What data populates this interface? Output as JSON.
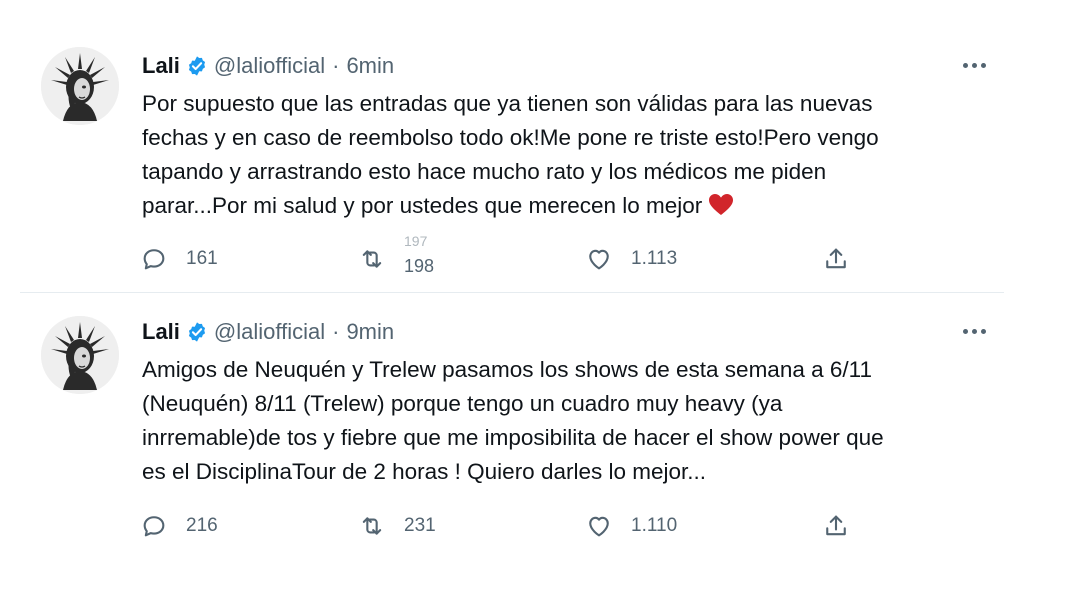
{
  "tweets": [
    {
      "display_name": "Lali",
      "handle": "@laliofficial",
      "separator": "·",
      "time": "6min",
      "lines": [
        "Por supuesto que las entradas que ya tienen son válidas para las nuevas",
        "fechas y en caso de reembolso todo ok!Me pone re triste esto!Pero vengo",
        "tapando y arrastrando esto hace mucho rato y los médicos me piden",
        "parar...Por mi salud y por ustedes que merecen lo mejor"
      ],
      "emoji": "red-heart",
      "replies": "161",
      "retweets_ghost": "197",
      "retweets": "198",
      "likes": "1.113"
    },
    {
      "display_name": "Lali",
      "handle": "@laliofficial",
      "separator": "·",
      "time": "9min",
      "lines": [
        "Amigos de Neuquén y Trelew pasamos los shows de esta semana a 6/11",
        "(Neuquén) 8/11 (Trelew) porque tengo un cuadro muy heavy (ya",
        "inrremable)de tos y fiebre que me imposibilita de hacer el show power que",
        "es el DisciplinaTour de 2 horas ! Quiero darles lo mejor..."
      ],
      "replies": "216",
      "retweets": "231",
      "likes": "1.110"
    }
  ],
  "icons": {
    "verified": "verified-badge-icon",
    "more": "more-options-icon",
    "reply": "reply-icon",
    "retweet": "retweet-icon",
    "like": "like-icon",
    "share": "share-icon"
  },
  "colors": {
    "verified_blue": "#1d9bf0",
    "text_primary": "#0f1419",
    "text_secondary": "#536471",
    "heart_red": "#d1252b"
  }
}
